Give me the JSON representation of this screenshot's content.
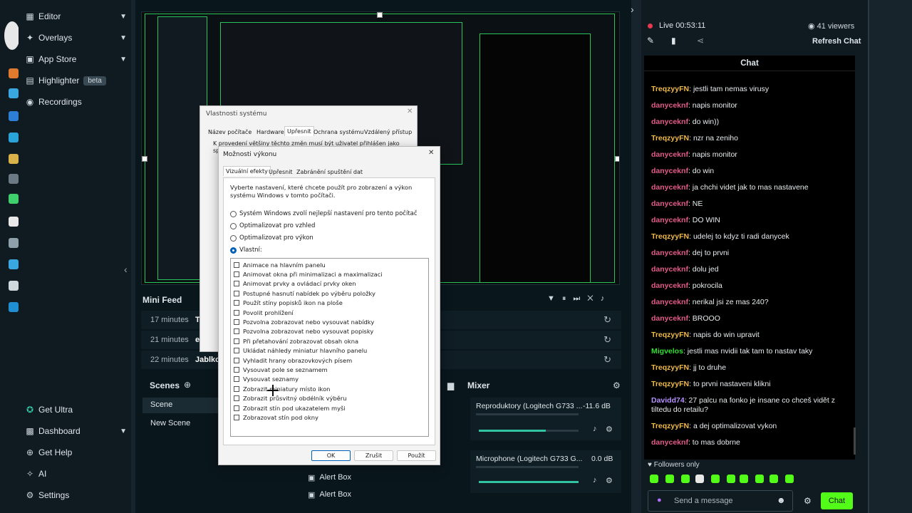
{
  "sidebar": {
    "items": [
      {
        "label": "Editor",
        "icon": "editor-icon"
      },
      {
        "label": "Overlays",
        "icon": "overlays-icon"
      },
      {
        "label": "App Store",
        "icon": "app-store-icon"
      },
      {
        "label": "Highlighter",
        "badge": "beta",
        "icon": "highlighter-icon"
      },
      {
        "label": "Recordings",
        "icon": "recordings-icon"
      }
    ],
    "bottom_items": [
      {
        "label": "Get Ultra",
        "icon": "ultra-icon"
      },
      {
        "label": "Dashboard",
        "icon": "dashboard-icon"
      },
      {
        "label": "Get Help",
        "icon": "help-icon"
      },
      {
        "label": "AI",
        "icon": "ai-icon"
      },
      {
        "label": "Settings",
        "icon": "gear-icon"
      }
    ]
  },
  "minifeed": {
    "title": "Mini Feed",
    "rows": [
      {
        "time": "17 minutes",
        "name": "T"
      },
      {
        "time": "21 minutes",
        "name": "e"
      },
      {
        "time": "22 minutes",
        "name": "Jablko"
      }
    ]
  },
  "scenes": {
    "title": "Scenes",
    "items": [
      "Scene",
      "New Scene"
    ]
  },
  "sources": {
    "items": [
      "Alert Box",
      "Alert Box"
    ]
  },
  "mixer": {
    "title": "Mixer",
    "channels": [
      {
        "name": "Reproduktory (Logitech G733 ...",
        "db": "-11.6 dB",
        "level": 0.67
      },
      {
        "name": "Microphone (Logitech G733 G...",
        "db": "0.0 dB",
        "level": 1.0
      }
    ]
  },
  "chat": {
    "live_label": "Live",
    "live_time": "00:53:11",
    "viewers": "41 viewers",
    "refresh": "Refresh Chat",
    "title": "Chat",
    "messages": [
      {
        "user": "TreqzyyFN",
        "text": "jestli tam nemas virusy",
        "color": "t"
      },
      {
        "user": "danyceknf",
        "text": "napis monitor",
        "color": "d"
      },
      {
        "user": "danyceknf",
        "text": "do win))",
        "color": "d"
      },
      {
        "user": "TreqzyyFN",
        "text": "nzr na zeniho",
        "color": "t"
      },
      {
        "user": "danyceknf",
        "text": "napis monitor",
        "color": "d"
      },
      {
        "user": "danyceknf",
        "text": "do win",
        "color": "d"
      },
      {
        "user": "danyceknf",
        "text": "ja chchi videt jak to mas nastavene",
        "color": "d"
      },
      {
        "user": "danyceknf",
        "text": "NE",
        "color": "d"
      },
      {
        "user": "danyceknf",
        "text": "DO WIN",
        "color": "d"
      },
      {
        "user": "TreqzyyFN",
        "text": "udelej to kdyz ti radi danycek",
        "color": "t"
      },
      {
        "user": "danyceknf",
        "text": "dej to prvni",
        "color": "d"
      },
      {
        "user": "danyceknf",
        "text": "dolu jed",
        "color": "d"
      },
      {
        "user": "danyceknf",
        "text": "pokrocila",
        "color": "d"
      },
      {
        "user": "danyceknf",
        "text": "nerikal jsi ze mas 240?",
        "color": "d"
      },
      {
        "user": "danyceknf",
        "text": "BROOO",
        "color": "d"
      },
      {
        "user": "TreqzyyFN",
        "text": "napis do win upravit",
        "color": "t"
      },
      {
        "user": "Migvelos",
        "text": "jestli mas nvidii tak tam to nastav taky",
        "color": "m"
      },
      {
        "user": "TreqzyyFN",
        "text": "jj to druhe",
        "color": "t"
      },
      {
        "user": "TreqzyyFN",
        "text": "to prvni nastaveni klikni",
        "color": "t"
      },
      {
        "user": "Davidd74",
        "text": "27 palcu na fonko je insane co chceš vidět z tiltedu do retailu?",
        "color": "v"
      },
      {
        "user": "TreqzyyFN",
        "text": "a dej optimalizovat vykon",
        "color": "t"
      },
      {
        "user": "danyceknf",
        "text": "to mas dobrne",
        "color": "d"
      }
    ],
    "followers_only": "Followers only",
    "placeholder": "Send a message",
    "send": "Chat"
  },
  "sysprops": {
    "title": "Vlastnosti systému",
    "tabs": [
      "Název počítače",
      "Hardware",
      "Upřesnit",
      "Ochrana systému",
      "Vzdálený přístup"
    ],
    "note": "K provedení většiny těchto změn musí být uživatel přihlášen jako správce."
  },
  "perf": {
    "title": "Možnosti výkonu",
    "tabs": [
      "Vizuální efekty",
      "Upřesnit",
      "Zabránění spuštění dat"
    ],
    "description": "Vyberte nastavení, které chcete použít pro zobrazení a výkon systému Windows v tomto počítači.",
    "radios": [
      "Systém Windows zvolí nejlepší nastavení pro tento počítač",
      "Optimalizovat pro vzhled",
      "Optimalizovat pro výkon",
      "Vlastní:"
    ],
    "checkboxes": [
      "Animace na hlavním panelu",
      "Animovat okna při minimalizaci a maximalizaci",
      "Animovat prvky a ovládací prvky oken",
      "Postupné hasnutí nabídek po výběru položky",
      "Použít stíny popisků ikon na ploše",
      "Povolit prohlížení",
      "Pozvolna zobrazovat nebo vysouvat nabídky",
      "Pozvolna zobrazovat nebo vysouvat popisky",
      "Při přetahování zobrazovat obsah okna",
      "Ukládat náhledy miniatur hlavního panelu",
      "Vyhladit hrany obrazovkových písem",
      "Vysouvat pole se seznamem",
      "Vysouvat seznamy",
      "Zobrazit miniatury místo ikon",
      "Zobrazit průsvitný obdélník výběru",
      "Zobrazit stín pod ukazatelem myši",
      "Zobrazovat stín pod okny"
    ],
    "ok": "OK",
    "cancel": "Zrušit",
    "apply": "Použít"
  },
  "colors": {
    "accent": "#31c3a2",
    "chat_green": "#53fc18",
    "live_red": "#e8384f"
  }
}
